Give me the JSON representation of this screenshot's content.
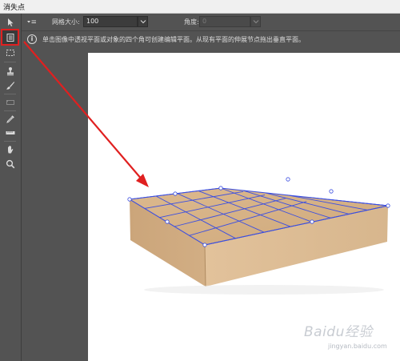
{
  "window": {
    "title": "消失点"
  },
  "options": {
    "grid_size_label": "网格大小:",
    "grid_size_value": "100",
    "angle_label": "角度:",
    "angle_value": "0"
  },
  "info": {
    "text": "单击图像中透视平面或对象的四个角可创建编辑平面。从现有平面的伸展节点拖出垂直平面。"
  },
  "tools": [
    {
      "name": "edit-plane",
      "icon": "arrow-select-icon"
    },
    {
      "name": "create-plane",
      "icon": "create-plane-icon",
      "active": true
    },
    {
      "name": "marquee",
      "icon": "marquee-icon"
    },
    {
      "name": "stamp",
      "icon": "stamp-icon"
    },
    {
      "name": "brush",
      "icon": "brush-icon"
    },
    {
      "name": "transform",
      "icon": "transform-icon"
    },
    {
      "name": "eyedropper",
      "icon": "eyedropper-icon"
    },
    {
      "name": "measure",
      "icon": "ruler-icon"
    },
    {
      "name": "hand",
      "icon": "hand-icon"
    },
    {
      "name": "zoom",
      "icon": "zoom-icon"
    }
  ],
  "watermark": {
    "brand": "Baidu经验",
    "url": "jingyan.baidu.com"
  },
  "colors": {
    "panel": "#535353",
    "annotation_red": "#e02020",
    "grid_blue": "#3c4fe0",
    "box_tan": "#d8b48b"
  }
}
